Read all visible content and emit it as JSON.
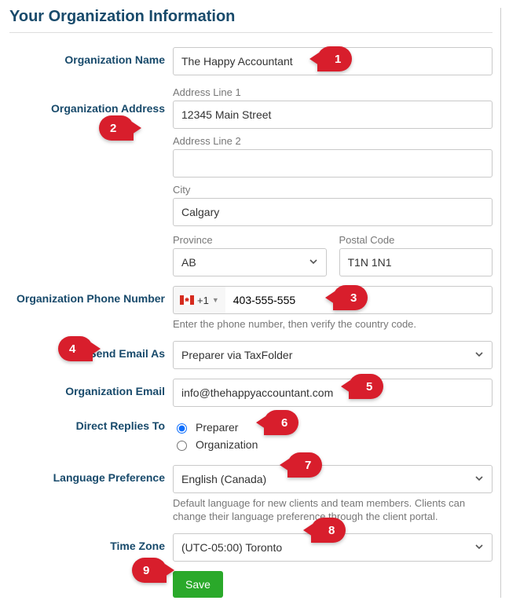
{
  "title": "Your Organization Information",
  "labels": {
    "org_name": "Organization Name",
    "org_address": "Organization Address",
    "addr1": "Address Line 1",
    "addr2": "Address Line 2",
    "city": "City",
    "province": "Province",
    "postal": "Postal Code",
    "phone": "Organization Phone Number",
    "phone_help": "Enter the phone number, then verify the country code.",
    "send_email_as": "Send Email As",
    "org_email": "Organization Email",
    "direct_replies": "Direct Replies To",
    "option_preparer": "Preparer",
    "option_organization": "Organization",
    "lang_pref": "Language Preference",
    "lang_help": "Default language for new clients and team members. Clients can change their language preference through the client portal.",
    "timezone": "Time Zone",
    "save": "Save",
    "dial_code": "+1"
  },
  "values": {
    "org_name": "The Happy Accountant",
    "addr1": "12345 Main Street",
    "addr2": "",
    "city": "Calgary",
    "province": "AB",
    "postal": "T1N 1N1",
    "phone": "403-555-555",
    "send_email_as": "Preparer via TaxFolder",
    "org_email": "info@thehappyaccountant.com",
    "direct_replies_selected": "Preparer",
    "lang_pref": "English (Canada)",
    "timezone": "(UTC-05:00) Toronto"
  },
  "pins": {
    "p1": "1",
    "p2": "2",
    "p3": "3",
    "p4": "4",
    "p5": "5",
    "p6": "6",
    "p7": "7",
    "p8": "8",
    "p9": "9"
  }
}
